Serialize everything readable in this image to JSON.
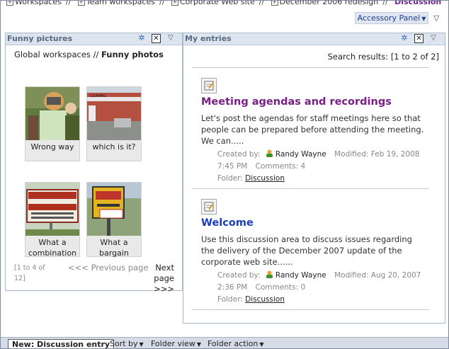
{
  "breadcrumbs": [
    {
      "label": "Workspaces",
      "active": false
    },
    {
      "label": "Team workspaces",
      "active": false
    },
    {
      "label": "Corporate Web site",
      "active": false
    },
    {
      "label": "December 2006 redesign",
      "active": false
    },
    {
      "label": "Discussion",
      "active": true
    }
  ],
  "accessory_panel": {
    "label": "Accessory Panel"
  },
  "left_panel": {
    "title": "Funny pictures",
    "path_prefix": "Global workspaces // ",
    "path_current": "Funny photos",
    "items": [
      {
        "caption": "Wrong way"
      },
      {
        "caption": "which is it?"
      },
      {
        "caption": "What a combination"
      },
      {
        "caption": "What a bargain"
      }
    ],
    "pager": {
      "count": "[1 to 4 of 12]",
      "prev": "<<< Previous page",
      "next": "Next page >>>"
    }
  },
  "right_panel": {
    "title": "My entries",
    "results": "Search results: [1 to 2 of 2]",
    "entries": [
      {
        "title": "Meeting agendas and recordings",
        "title_color": "#7a1f86",
        "body": "Let's post the agendas for staff meetings here so that people can be prepared before attending the meeting. We can.....",
        "created_label": "Created by:",
        "author": "Randy Wayne",
        "modified": "Modified: Feb 19, 2008 7:45 PM",
        "comments": "Comments: 4",
        "folder_label": "Folder:",
        "folder": "Discussion"
      },
      {
        "title": "Welcome",
        "title_color": "#1a3fb8",
        "body": "Use this discussion area to discuss issues regarding the delivery of the December 2007 update of the corporate web site......",
        "created_label": "Created by:",
        "author": "Randy Wayne",
        "modified": "Modified: Aug 20, 2007 2:36 PM",
        "comments": "Comments: 0",
        "folder_label": "Folder:",
        "folder": "Discussion"
      }
    ]
  },
  "toolbar": {
    "new_label": "New: Discussion entry",
    "sort_label": "Sort by",
    "folder_view_label": "Folder view",
    "folder_action_label": "Folder action"
  }
}
